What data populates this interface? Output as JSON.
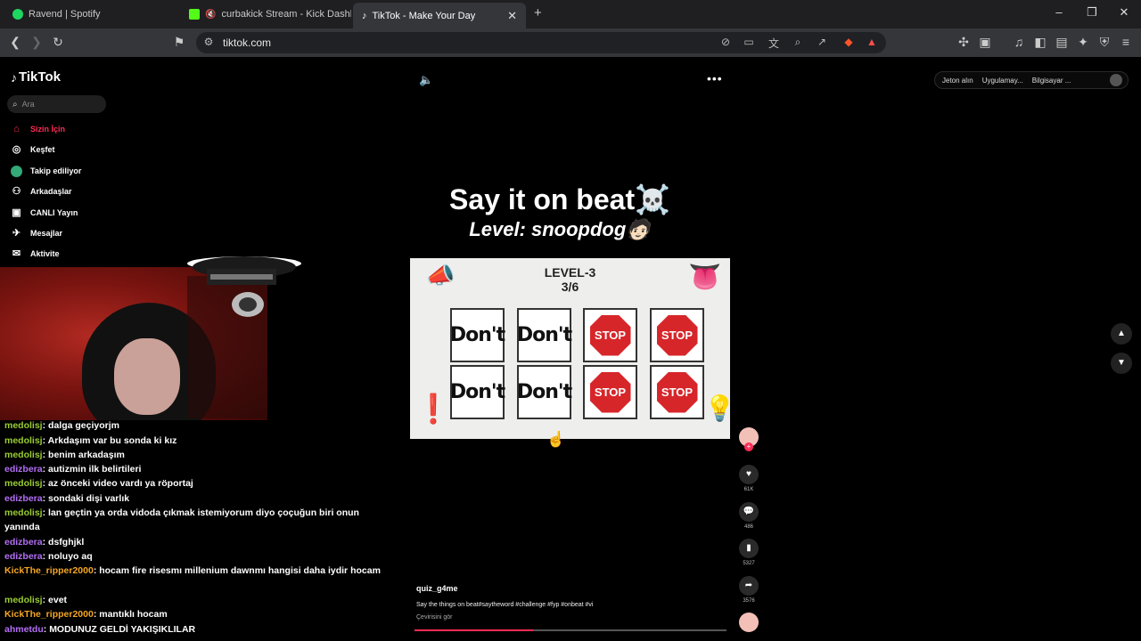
{
  "browser": {
    "tabs": [
      {
        "title": "Ravend | Spotify",
        "favicon": "spotify-icon",
        "color": "#1ed760"
      },
      {
        "title": "curbakick Stream - Kick Dashboa",
        "favicon": "kick-icon",
        "color": "#53fc18"
      },
      {
        "title": "TikTok - Make Your Day",
        "favicon": "tiktok-icon",
        "color": "#ffffff",
        "active": true
      }
    ],
    "new_tab_label": "+",
    "url": "tiktok.com",
    "window_controls": {
      "minimize": "–",
      "restore": "❐",
      "close": "✕"
    }
  },
  "tiktok": {
    "logo": "TikTok",
    "search_placeholder": "Ara",
    "nav": [
      {
        "label": "Sizin İçin",
        "icon": "home-icon",
        "active": true
      },
      {
        "label": "Keşfet",
        "icon": "compass-icon"
      },
      {
        "label": "Takip ediliyor",
        "icon": "following-icon"
      },
      {
        "label": "Arkadaşlar",
        "icon": "friends-icon"
      },
      {
        "label": "CANLI Yayın",
        "icon": "live-icon"
      },
      {
        "label": "Mesajlar",
        "icon": "messages-icon"
      },
      {
        "label": "Aktivite",
        "icon": "activity-icon"
      }
    ],
    "header_actions": [
      "Jeton alın",
      "Uygulamay...",
      "Bilgisayar ..."
    ],
    "video": {
      "title": "Say it on beat☠️",
      "subtitle": "Level: snoopdog🧑🏻",
      "level": "LEVEL-3",
      "progress_label": "3/6",
      "cards": [
        "Don't",
        "Don't",
        "STOP",
        "STOP",
        "Don't",
        "Don't",
        "STOP",
        "STOP"
      ],
      "author": "quiz_g4me",
      "caption": "Say the things on beat#saytheword #challenge #fyp #onbeat #vi",
      "translate": "Çevirisini gör",
      "playback_progress": 0.38
    },
    "actions": [
      {
        "name": "like",
        "icon": "heart-icon",
        "count": "61K"
      },
      {
        "name": "comment",
        "icon": "comment-icon",
        "count": "486"
      },
      {
        "name": "save",
        "icon": "bookmark-icon",
        "count": "5327"
      },
      {
        "name": "share",
        "icon": "share-icon",
        "count": "3576"
      }
    ]
  },
  "chat": [
    {
      "user": "medolisj",
      "color": "#9acd32",
      "text": "dalga geçiyorjm"
    },
    {
      "user": "medolisj",
      "color": "#9acd32",
      "text": "Arkdaşım var bu sonda ki kız"
    },
    {
      "user": "medolisj",
      "color": "#9acd32",
      "text": "benim arkadaşım"
    },
    {
      "user": "edizbera",
      "color": "#b36ef5",
      "text": "autizmin ilk belirtileri"
    },
    {
      "user": "medolisj",
      "color": "#9acd32",
      "text": "az önceki video vardı ya röportaj"
    },
    {
      "user": "edizbera",
      "color": "#b36ef5",
      "text": "sondaki dişi varlık"
    },
    {
      "user": "medolisj",
      "color": "#9acd32",
      "text": "lan geçtin ya orda vidoda çıkmak istemiyorum diyo çoçuğun biri onun yanında"
    },
    {
      "user": "edizbera",
      "color": "#b36ef5",
      "text": "dsfghjkl"
    },
    {
      "user": "edizbera",
      "color": "#b36ef5",
      "text": "noluyo aq"
    },
    {
      "user": "KickThe_ripper2000",
      "color": "#f5a623",
      "text": "hocam fire risesmı millenium dawnmı hangisi daha iydir hocam"
    },
    {
      "user": "medolisj",
      "color": "#9acd32",
      "text": "evet"
    },
    {
      "user": "KickThe_ripper2000",
      "color": "#f5a623",
      "text": "mantıklı hocam"
    },
    {
      "user": "ahmetdu",
      "color": "#b36ef5",
      "text": "MODUNUZ GELDİ YAKIŞIKLILAR"
    }
  ]
}
